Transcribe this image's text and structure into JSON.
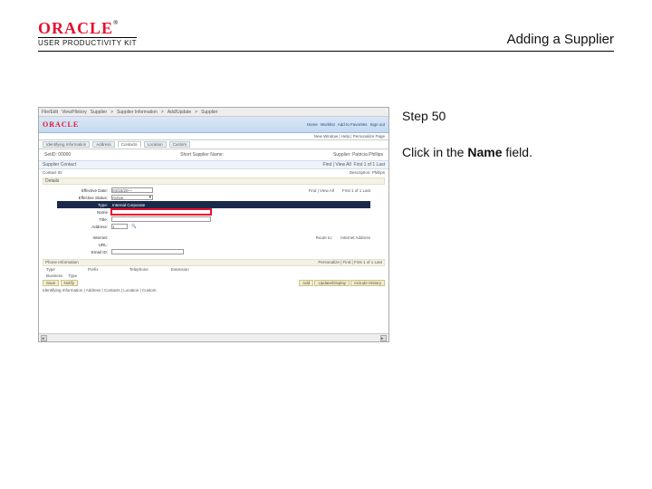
{
  "header": {
    "logo_text": "ORACLE",
    "logo_tm": "®",
    "subbrand": "USER PRODUCTIVITY KIT",
    "doc_title": "Adding a Supplier"
  },
  "instruction": {
    "step_label": "Step 50",
    "pre_text": "Click in the ",
    "bold_text": "Name",
    "post_text": " field."
  },
  "screenshot": {
    "browser": {
      "menu": [
        "File/Edit",
        "View/History",
        "Supplier",
        "Supplier Information",
        "Add/Update",
        "Supplier"
      ]
    },
    "app_logo": "ORACLE",
    "topnav": [
      "Home",
      "Worklist",
      "Add to Favorites",
      "Sign out"
    ],
    "user_bar": "New Window | Help | Personalize Page",
    "tabs": [
      "Identifying Information",
      "Address",
      "Contacts",
      "Location",
      "Custom"
    ],
    "active_tab_index": 2,
    "supplier_header": {
      "setid_label": "SetID:",
      "setid_value": "00000",
      "short_label": "Short Supplier Name:",
      "supplier_label": "Supplier:",
      "supplier_value": "Patricia Phillips"
    },
    "contacts_band": {
      "left": "Supplier Contact",
      "right_find": "Find | View All",
      "right_count": "First  1 of 1  Last"
    },
    "contact_line": {
      "contact_id_label": "Contact ID:",
      "description_label": "Description:",
      "description_value": "Phillips"
    },
    "details_bar": "Details",
    "form": {
      "eff_date": {
        "label": "Effective Date:",
        "value": "04/15/20—"
      },
      "eff_status": {
        "label": "Effective Status:",
        "value": "Active"
      },
      "type": {
        "label": "Type:",
        "value": "Internal Corporate"
      },
      "name": {
        "label": "Name"
      },
      "title": {
        "label": "Title:"
      },
      "address": {
        "label": "Address:",
        "value": "1"
      },
      "internet": {
        "label": "Internet:",
        "value": ""
      },
      "url": {
        "label": "URL:"
      },
      "email": {
        "label": "Email ID:"
      },
      "find_view": "Find | View All",
      "find_count": "First  1 of 1  Last",
      "route_label": "Route to:",
      "route_value": "Internet Address"
    },
    "phone_band": {
      "left": "Phone Information",
      "right": "Personalize | Find |   First  1 of 1  Last"
    },
    "phone_head": [
      "Type",
      "Prefix",
      "Telephone",
      "Extension"
    ],
    "biz_row": {
      "label": "Business",
      "sel": "Type"
    },
    "btn_row": {
      "left": [
        "Save",
        "Notify"
      ],
      "right": [
        "Add",
        "Update/Display",
        "Include History"
      ]
    },
    "footer_note": "Identifying Information | Address | Contacts | Location | Custom"
  }
}
